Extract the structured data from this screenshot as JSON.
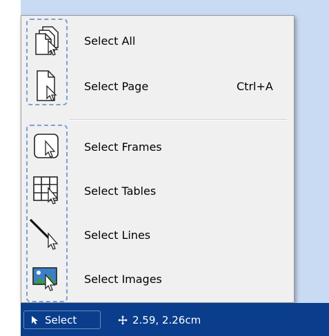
{
  "menu": {
    "items": [
      {
        "label": "Select All",
        "shortcut": "",
        "icon": "select-all-icon"
      },
      {
        "label": "Select Page",
        "shortcut": "Ctrl+A",
        "icon": "select-page-icon"
      },
      {
        "label": "Select Frames",
        "shortcut": "",
        "icon": "select-frames-icon"
      },
      {
        "label": "Select Tables",
        "shortcut": "",
        "icon": "select-tables-icon"
      },
      {
        "label": "Select Lines",
        "shortcut": "",
        "icon": "select-lines-icon"
      },
      {
        "label": "Select Images",
        "shortcut": "",
        "icon": "select-images-icon"
      }
    ]
  },
  "statusbar": {
    "select_label": "Select",
    "coordinates": "2.59, 2.26cm",
    "select_icon": "cursor-icon",
    "coord_icon": "move-icon"
  },
  "colors": {
    "statusbar": "#0a3e8c",
    "menu_bg": "#f0f0f0",
    "dashed_border": "#7a9fd3",
    "background": "#c9dbf2"
  }
}
